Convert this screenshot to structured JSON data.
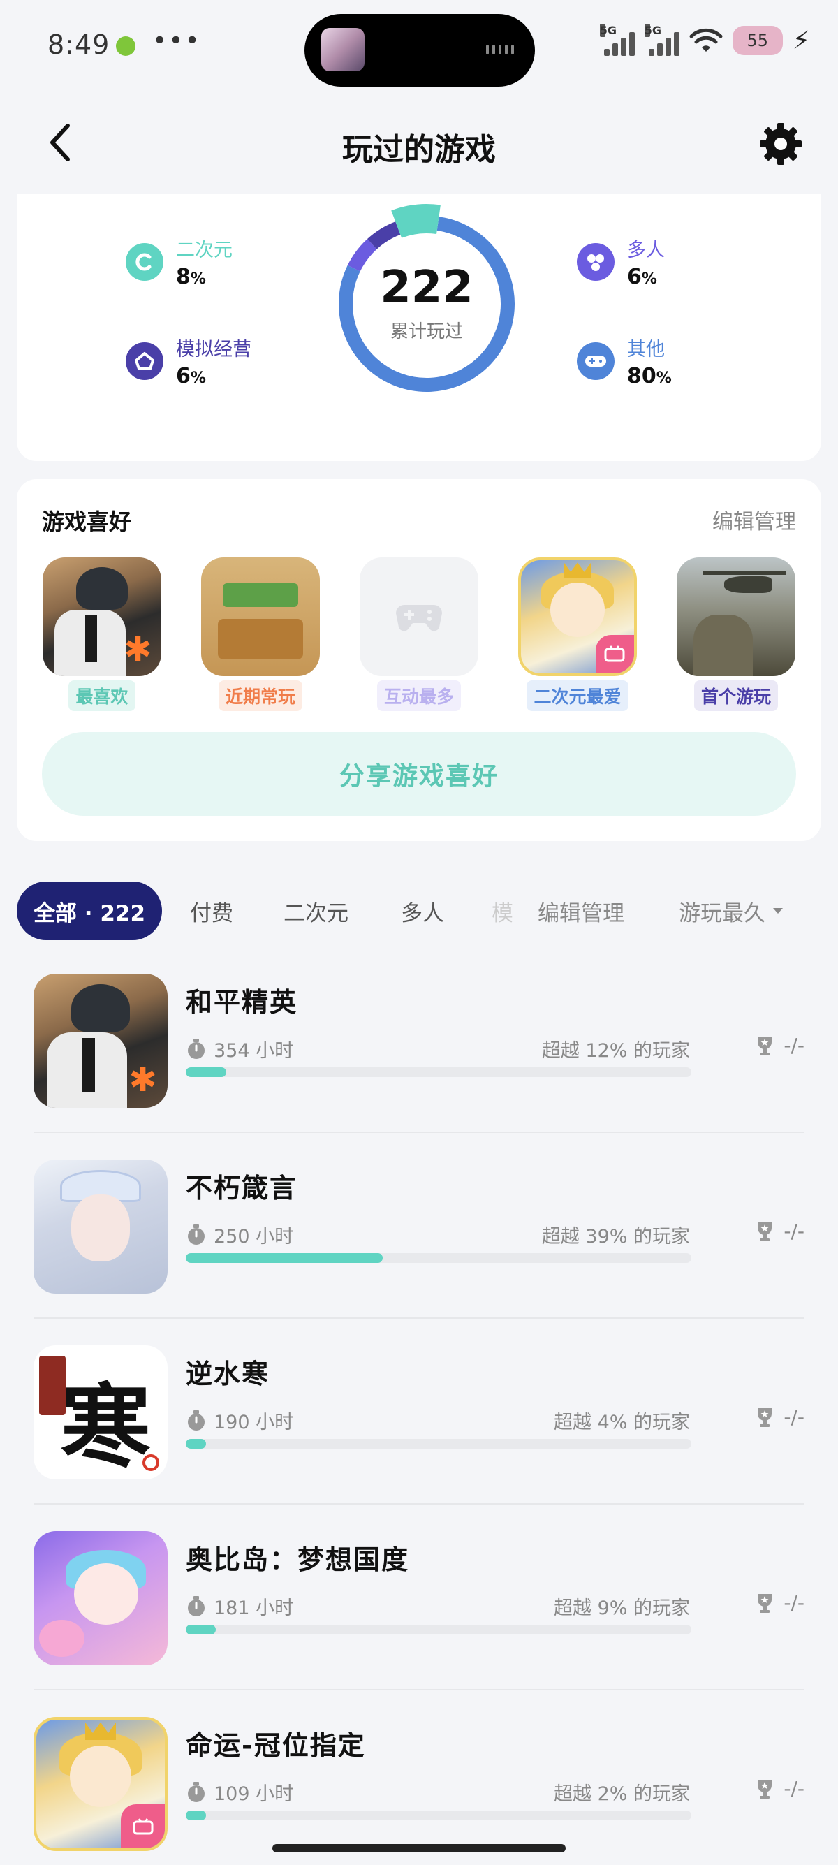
{
  "status_bar": {
    "time": "8:49",
    "dots": "•••",
    "network_1": "5G",
    "network_2": "5G",
    "battery": "55"
  },
  "header": {
    "title": "玩过的游戏"
  },
  "stats": {
    "total": "222",
    "total_label": "累计玩过",
    "categories": [
      {
        "label": "二次元",
        "value": "8",
        "unit": "%",
        "color": "#5fd4c2",
        "icon": "anime-icon"
      },
      {
        "label": "模拟经营",
        "value": "6",
        "unit": "%",
        "color": "#4a3fa8",
        "icon": "simulation-icon"
      },
      {
        "label": "多人",
        "value": "6",
        "unit": "%",
        "color": "#6b5ce0",
        "icon": "multiplayer-icon"
      },
      {
        "label": "其他",
        "value": "80",
        "unit": "%",
        "color": "#4f84d8",
        "icon": "gamepad-icon"
      }
    ]
  },
  "preferences": {
    "title": "游戏喜好",
    "edit_label": "编辑管理",
    "items": [
      {
        "tag": "最喜欢",
        "tag_color": "#5cc7b4",
        "tag_bg": "#e3f6f2"
      },
      {
        "tag": "近期常玩",
        "tag_color": "#f07d4a",
        "tag_bg": "#fdece3"
      },
      {
        "tag": "互动最多",
        "tag_color": "#b9b0ef",
        "tag_bg": "#f1effc"
      },
      {
        "tag": "二次元最爱",
        "tag_color": "#4f84d8",
        "tag_bg": "#e6effb"
      },
      {
        "tag": "首个游玩",
        "tag_color": "#4a3fa8",
        "tag_bg": "#ebe9f6"
      }
    ],
    "share_label": "分享游戏喜好"
  },
  "filters": {
    "all": "全部 · 222",
    "paid": "付费",
    "anime": "二次元",
    "multiplayer": "多人",
    "faded": "模",
    "edit": "编辑管理",
    "sort": "游玩最久"
  },
  "games": [
    {
      "name": "和平精英",
      "hours": "354 小时",
      "percentile": "超越 12% 的玩家",
      "progress": 0.08,
      "trophy": "-/-"
    },
    {
      "name": "不朽箴言",
      "hours": "250 小时",
      "percentile": "超越 39% 的玩家",
      "progress": 0.39,
      "trophy": "-/-"
    },
    {
      "name": "逆水寒",
      "hours": "190 小时",
      "percentile": "超越 4% 的玩家",
      "progress": 0.04,
      "trophy": "-/-"
    },
    {
      "name": "奥比岛：梦想国度",
      "hours": "181 小时",
      "percentile": "超越 9% 的玩家",
      "progress": 0.06,
      "trophy": "-/-"
    },
    {
      "name": "命运-冠位指定",
      "hours": "109 小时",
      "percentile": "超越 2% 的玩家",
      "progress": 0.04,
      "trophy": "-/-"
    }
  ]
}
